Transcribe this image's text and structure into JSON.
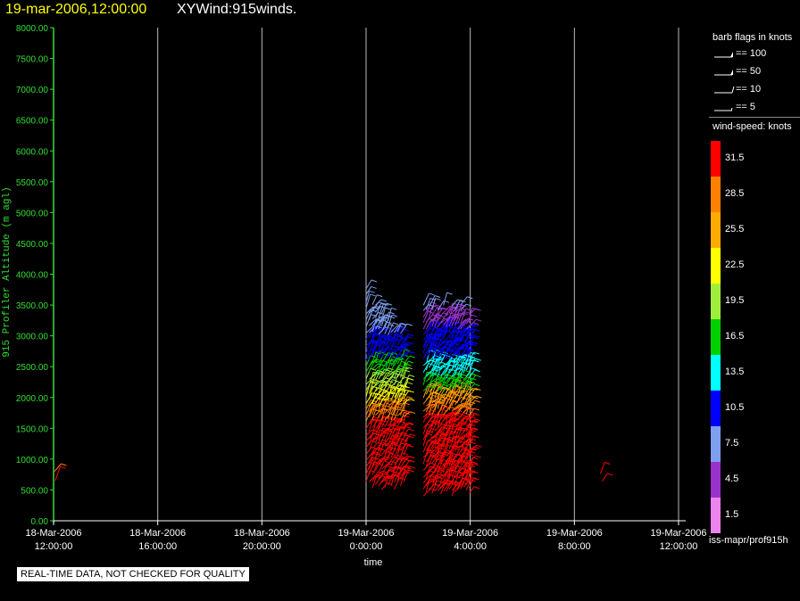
{
  "header": {
    "datetime": "19-mar-2006,12:00:00",
    "plot_name": "XYWind:915winds."
  },
  "legend": {
    "barb_title": "barb flags in knots",
    "barb_flags": [
      {
        "label": "== 100",
        "value": 100
      },
      {
        "label": "== 50",
        "value": 50
      },
      {
        "label": "== 10",
        "value": 10
      },
      {
        "label": "== 5",
        "value": 5
      }
    ],
    "speed_title": "wind-speed: knots",
    "colorbar": [
      {
        "label": "31.5",
        "color": "#ff0000"
      },
      {
        "label": "28.5",
        "color": "#ff7f00"
      },
      {
        "label": "25.5",
        "color": "#ffaa00"
      },
      {
        "label": "22.5",
        "color": "#ffff00"
      },
      {
        "label": "19.5",
        "color": "#a0ee3c"
      },
      {
        "label": "16.5",
        "color": "#00d000"
      },
      {
        "label": "13.5",
        "color": "#00ffff"
      },
      {
        "label": "10.5",
        "color": "#0000ff"
      },
      {
        "label": "7.5",
        "color": "#7e9ef0"
      },
      {
        "label": "4.5",
        "color": "#9932cc"
      },
      {
        "label": "1.5",
        "color": "#ee82ee"
      }
    ],
    "footer": "iss-mapr/prof915h"
  },
  "qc_note": "REAL-TIME DATA, NOT CHECKED FOR QUALITY",
  "colors": {
    "background": "#000000",
    "y_axis": "#33dd33",
    "x_axis": "#ffffff",
    "gridline": "#bbbbbb",
    "title_date": "#ffff00"
  },
  "chart_data": {
    "type": "wind-barb",
    "ylabel": "915 Profiler Altitude (m agl)",
    "xlabel": "time",
    "ylim": [
      0,
      8000
    ],
    "y_ticks": [
      "0.00",
      "500.00",
      "1000.00",
      "1500.00",
      "2000.00",
      "2500.00",
      "3000.00",
      "3500.00",
      "4000.00",
      "4500.00",
      "5000.00",
      "5500.00",
      "6000.00",
      "6500.00",
      "7000.00",
      "7500.00",
      "8000.00"
    ],
    "x_ticks": [
      {
        "date": "18-Mar-2006",
        "time": "12:00:00"
      },
      {
        "date": "18-Mar-2006",
        "time": "16:00:00"
      },
      {
        "date": "18-Mar-2006",
        "time": "20:00:00"
      },
      {
        "date": "19-Mar-2006",
        "time": "0:00:00"
      },
      {
        "date": "19-Mar-2006",
        "time": "4:00:00"
      },
      {
        "date": "19-Mar-2006",
        "time": "8:00:00"
      },
      {
        "date": "19-Mar-2006",
        "time": "12:00:00"
      }
    ],
    "x_range": [
      "18-Mar-2006 12:00:00",
      "19-Mar-2006 12:00:00"
    ],
    "grid": "vertical lines at each time tick",
    "profiles": [
      {
        "time": "18-Mar-2006 12:00:00",
        "alt_min": 500,
        "alt_max": 800,
        "speed": "low-level red"
      },
      {
        "time": "19-Mar-2006 00:00 to 01:30",
        "alt_min": 500,
        "alt_max": 3800,
        "speed": "red below 1600 m, yellow-green 1800-2400 m, blue above 2600 m"
      },
      {
        "time": "19-Mar-2006 02:15 to 04:00",
        "alt_min": 400,
        "alt_max": 3800,
        "speed": "red below 1700 m, green-cyan 1900-2600 m, blue/purple above 2800 m"
      },
      {
        "time": "19-Mar-2006 09:00",
        "alt_min": 500,
        "alt_max": 800,
        "speed": "red"
      }
    ]
  }
}
